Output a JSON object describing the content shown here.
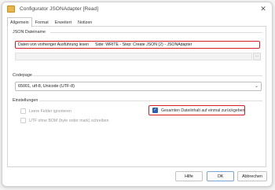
{
  "window": {
    "title": "Configurator JSONAdapter [Read]",
    "close_glyph": "✕",
    "app_icon": "folder-icon"
  },
  "tabs": [
    {
      "label": "Allgemein",
      "active": true
    },
    {
      "label": "Format",
      "active": false
    },
    {
      "label": "Erweitert",
      "active": false
    },
    {
      "label": "Notizen",
      "active": false
    }
  ],
  "json_file": {
    "group_label": "JSON Dateiname",
    "row_label": "Daten von vorheriger Ausführung lesen",
    "row_value": "Side: WRITE - Step: Create JSON (2) - JSONAdapter",
    "path_value": "",
    "browse_glyph": "…"
  },
  "codepage": {
    "group_label": "Codepage",
    "selected": "65001, utf-8, Unicode (UTF-8)",
    "chevron": "⌄"
  },
  "settings": {
    "group_label": "Einstellungen",
    "options": [
      {
        "label": "Leere Felder ignorieren",
        "checked": false,
        "enabled": false
      },
      {
        "label": "UTF ohne BOM (byte order mark) schreiben",
        "checked": false,
        "enabled": false
      },
      {
        "label": "Gesamten Dateiinhalt auf einmal zurückgeben",
        "checked": true,
        "enabled": true
      }
    ]
  },
  "footer": {
    "help": "Hilfe",
    "ok": "OK",
    "cancel": "Abbrechen"
  },
  "colors": {
    "highlight": "#d11f2a",
    "checkbox_accent": "#2e5fa8"
  }
}
